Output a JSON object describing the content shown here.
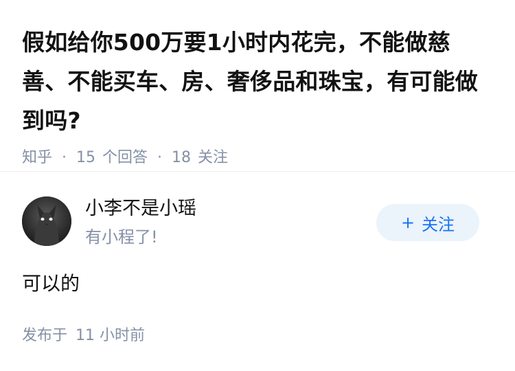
{
  "question": {
    "title": "假如给你500万要1小时内花完，不能做慈善、不能买车、房、奢侈品和珠宝，有可能做到吗?",
    "source": "知乎",
    "answer_count": "15",
    "answer_label": "个回答",
    "follow_count": "18",
    "follow_label": "关注"
  },
  "author": {
    "name": "小李不是小瑶",
    "bio": "有小程了!",
    "avatar_icon": "cat-avatar-icon",
    "follow_button": "关注"
  },
  "answer": {
    "text": "可以的",
    "published_label": "发布于",
    "time": "11 小时前"
  },
  "colors": {
    "accent": "#1772f6",
    "button_bg": "#ebf3fb",
    "meta_gray": "#8590a6",
    "text": "#121212"
  }
}
